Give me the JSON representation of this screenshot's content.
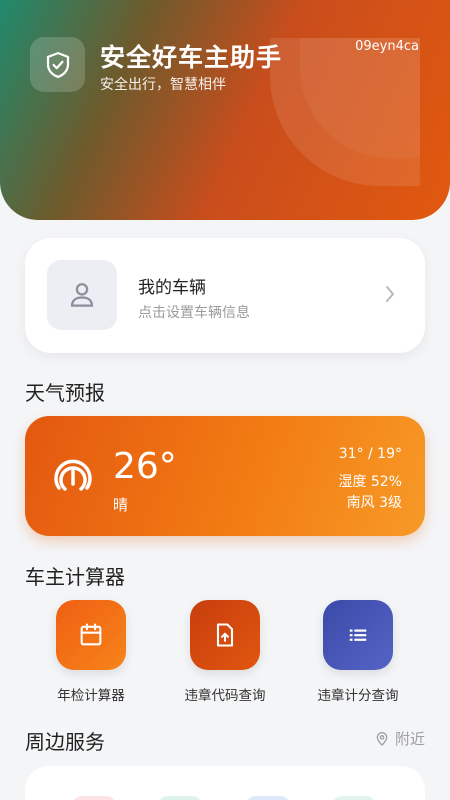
{
  "header": {
    "title": "安全好车主助手",
    "subtitle": "安全出行，智慧相伴",
    "user_id": "09eyn4ca",
    "icon": "shield-check-icon"
  },
  "vehicle": {
    "title": "我的车辆",
    "subtitle": "点击设置车辆信息",
    "icon": "user-icon"
  },
  "weather": {
    "section_title": "天气预报",
    "temperature": "26°",
    "condition": "晴",
    "range": "31° / 19°",
    "humidity": "湿度 52%",
    "wind": "南风 3级"
  },
  "calculators": {
    "section_title": "车主计算器",
    "items": [
      {
        "label": "年检计算器",
        "icon": "calendar-icon",
        "color": "#f06a12"
      },
      {
        "label": "违章代码查询",
        "icon": "file-upload-icon",
        "color": "#d8480f"
      },
      {
        "label": "违章计分查询",
        "icon": "list-icon",
        "color": "#4351b3"
      }
    ]
  },
  "nearby": {
    "section_title": "周边服务",
    "link": "附近"
  }
}
